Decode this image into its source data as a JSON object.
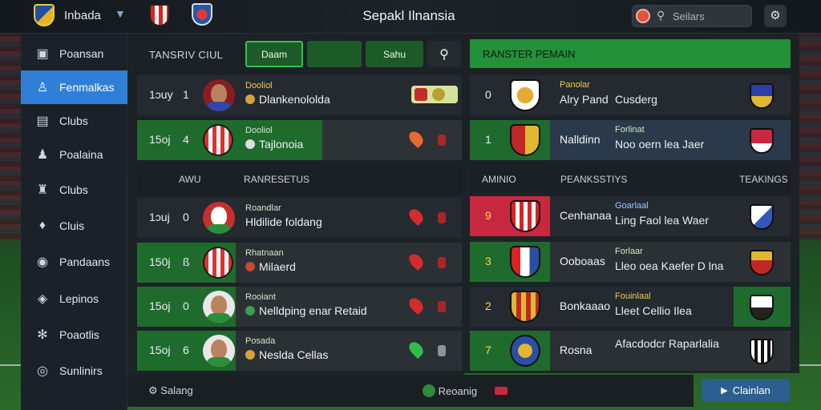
{
  "topbar": {
    "team_select": "Inbada",
    "title": "Sepakl Ilnansia",
    "search_placeholder": "Seilars"
  },
  "sidebar": {
    "items": [
      {
        "label": "Poansan",
        "icon": "tag-icon"
      },
      {
        "label": "Fenmalkas",
        "icon": "users-icon"
      },
      {
        "label": "Clubs",
        "icon": "table-icon"
      },
      {
        "label": "Poalaina",
        "icon": "person-icon"
      },
      {
        "label": "Clubs",
        "icon": "trophy-icon"
      },
      {
        "label": "Cluis",
        "icon": "pin-icon"
      },
      {
        "label": "Pandaans",
        "icon": "helmet-icon"
      },
      {
        "label": "Lepinos",
        "icon": "shield-icon"
      },
      {
        "label": "Poaotlis",
        "icon": "settings-icon"
      },
      {
        "label": "Sunlinirs",
        "icon": "globe-icon"
      }
    ]
  },
  "left_panel": {
    "header": "TANSRIV CIUL",
    "tabs": [
      "Daam",
      "",
      "Sahu"
    ],
    "top_rows": [
      {
        "rank": "1",
        "prefix": "1ɔuy",
        "tag": "Dooliol",
        "name": "Dlankenololda"
      },
      {
        "rank": "4",
        "prefix": "15oj",
        "tag": "Dooliol",
        "name": "Tajlonoia"
      }
    ],
    "section_hdr": {
      "col1": "AWU",
      "col2": "RANRESETUS"
    },
    "rows": [
      {
        "rank": "0",
        "prefix": "1ɔuj",
        "tag": "Roandlar",
        "name": "Hldilide foldang"
      },
      {
        "rank": "ß",
        "prefix": "150j",
        "tag": "Rhatnaan",
        "name": "Milaerd"
      },
      {
        "rank": "0",
        "prefix": "15oj",
        "tag": "Rooiant",
        "name": "Nelldping enar Retaid"
      },
      {
        "rank": "6",
        "prefix": "15oj",
        "tag": "Posada",
        "name": "Neslda Cellas"
      }
    ],
    "footer_left": "Salang",
    "footer_right": "Reoanig"
  },
  "right_panel": {
    "header": "RANSTER PEMAIN",
    "top_rows": [
      {
        "rank": "0",
        "name": "Alry Pand",
        "tag": "Panolar",
        "sub": "Cusderg"
      },
      {
        "rank": "1",
        "name": "Nalldinn",
        "tag": "Forlinat",
        "sub": "Noo oern lea Jaer"
      }
    ],
    "section_hdr": {
      "col1": "AMINIO",
      "col2": "PEANKSSTIYS",
      "col3": "TEAKINGS"
    },
    "rows": [
      {
        "rank": "9",
        "name": "Cenhanaa",
        "tag": "Goarlaal",
        "sub": "Ling Faol lea Waer"
      },
      {
        "rank": "3",
        "name": "Ooboaas",
        "tag": "Forlaar",
        "sub": "Lleo oea Kaefer D lna"
      },
      {
        "rank": "2",
        "name": "Bonkaaao",
        "tag": "Fouinlaal",
        "sub": "Lleet Cellio Ilea"
      },
      {
        "rank": "7",
        "name": "Rosna",
        "tag": "",
        "sub": "Afacdodcr Raparlalia"
      }
    ],
    "cta": "Clainlan"
  },
  "colors": {
    "accent_blue": "#2f7fd8",
    "row_green": "#1f6b2e",
    "highlight_red": "#c8283f"
  }
}
